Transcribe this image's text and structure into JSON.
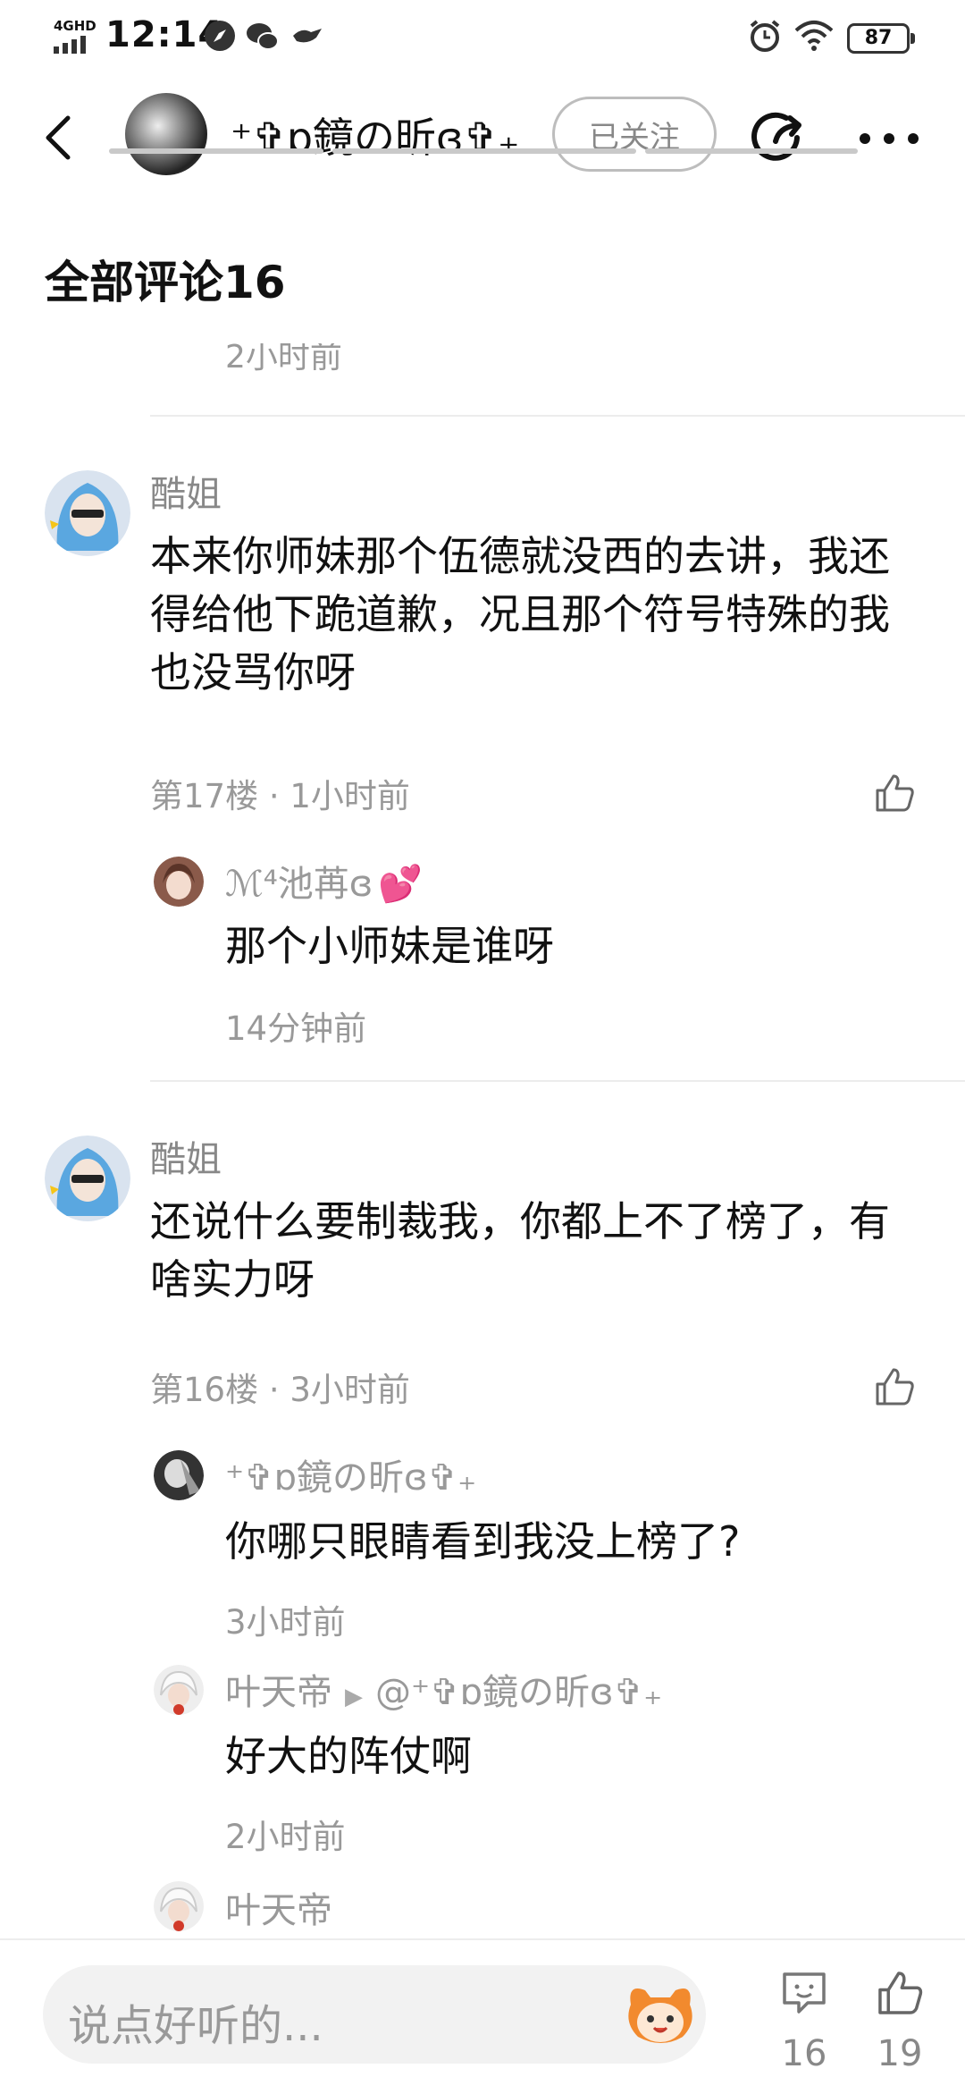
{
  "status_bar": {
    "network": "4GHD",
    "time": "12:14",
    "battery": "87",
    "colors": {
      "icon": "#333333"
    }
  },
  "header": {
    "user_name": "⁺✞ɒ鏡の昕ɞ✞₊",
    "follow_label": "已关注"
  },
  "comments_section": {
    "title": "全部评论16",
    "partial_time": "2小时前"
  },
  "comments": [
    {
      "author": "酷姐",
      "text": "本来你师妹那个伍德就没西的去讲，我还得给他下跪道歉，况且那个符号特殊的我也没骂你呀",
      "meta": "第17楼 · 1小时前",
      "replies": [
        {
          "author": "ℳ⁴池苒ɞ",
          "text": "那个小师妹是谁呀",
          "time": "14分钟前"
        }
      ]
    },
    {
      "author": "酷姐",
      "text": "还说什么要制裁我，你都上不了榜了，有啥实力呀",
      "meta": "第16楼 · 3小时前",
      "replies": [
        {
          "author": "⁺✞ɒ鏡の昕ɞ✞₊",
          "text": "你哪只眼睛看到我没上榜了?",
          "time": "3小时前"
        },
        {
          "author": "叶天帝",
          "reply_to": "@⁺✞ɒ鏡の昕ɞ✞₊",
          "text": "好大的阵仗啊",
          "time": "2小时前"
        },
        {
          "author": "叶天帝"
        }
      ]
    }
  ],
  "bottom_bar": {
    "input_placeholder": "说点好听的...",
    "comment_count": "16",
    "like_count": "19"
  },
  "colors": {
    "accent_red": "#ff4b6a",
    "muted_text": "#999999",
    "avatar_hair": "#5aa7e0"
  }
}
